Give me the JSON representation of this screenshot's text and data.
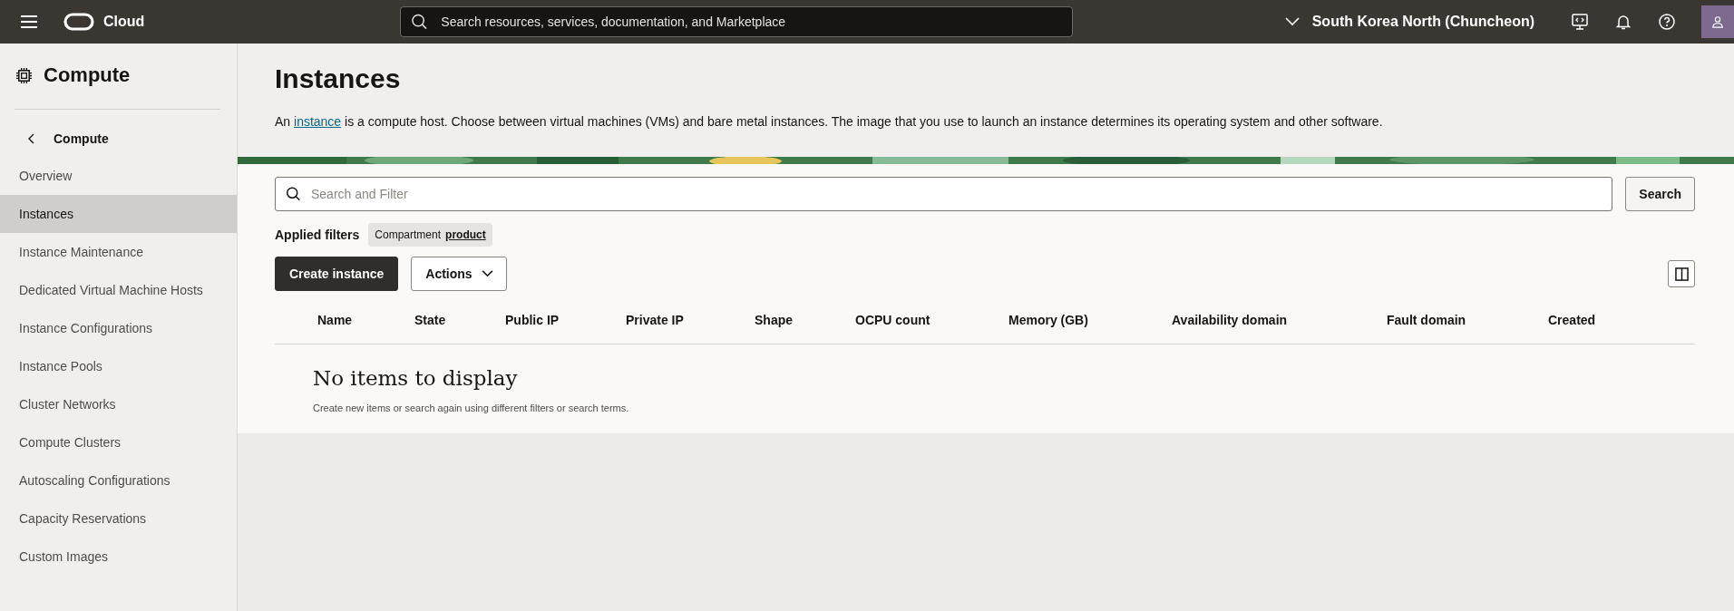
{
  "top_bar": {
    "brand": "Cloud",
    "search": {
      "placeholder": "Search resources, services, documentation, and Marketplace"
    },
    "region": "South Korea North (Chuncheon)"
  },
  "sidebar": {
    "title": "Compute",
    "back_label": "Compute",
    "items": [
      {
        "label": "Overview",
        "selected": false
      },
      {
        "label": "Instances",
        "selected": true
      },
      {
        "label": "Instance Maintenance",
        "selected": false
      },
      {
        "label": "Dedicated Virtual Machine Hosts",
        "selected": false
      },
      {
        "label": "Instance Configurations",
        "selected": false
      },
      {
        "label": "Instance Pools",
        "selected": false
      },
      {
        "label": "Cluster Networks",
        "selected": false
      },
      {
        "label": "Compute Clusters",
        "selected": false
      },
      {
        "label": "Autoscaling Configurations",
        "selected": false
      },
      {
        "label": "Capacity Reservations",
        "selected": false
      },
      {
        "label": "Custom Images",
        "selected": false
      }
    ]
  },
  "page": {
    "title": "Instances",
    "description": {
      "before": "An ",
      "link": "instance",
      "after": " is a compute host. Choose between virtual machines (VMs) and bare metal instances. The image that you use to launch an instance determines its operating system and other software."
    }
  },
  "filter": {
    "placeholder": "Search and Filter",
    "search_button": "Search",
    "applied_label": "Applied filters",
    "chips": [
      {
        "name": "Compartment",
        "value": "product"
      }
    ]
  },
  "actions": {
    "create": "Create instance",
    "menu": "Actions"
  },
  "table": {
    "columns": [
      "Name",
      "State",
      "Public IP",
      "Private IP",
      "Shape",
      "OCPU count",
      "Memory (GB)",
      "Availability domain",
      "Fault domain",
      "Created"
    ],
    "empty": {
      "title": "No items to display",
      "message": "Create new items or search again using different filters or search terms."
    }
  }
}
